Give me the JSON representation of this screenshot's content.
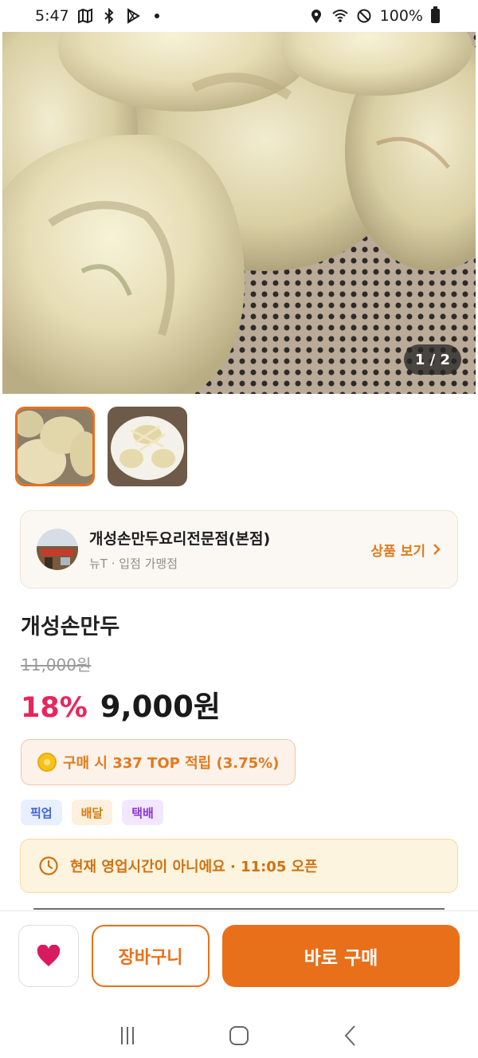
{
  "status_bar": {
    "time": "5:47",
    "battery": "100%",
    "left_icons": [
      "map-icon",
      "bluetooth-icon",
      "play-store-icon",
      "dot-icon"
    ],
    "right_icons": [
      "location-icon",
      "wifi-icon",
      "do-not-disturb-icon",
      "battery-icon"
    ]
  },
  "gallery": {
    "page_indicator": "1 / 2",
    "current_page": 1,
    "total_pages": 2
  },
  "shop": {
    "name": "개성손만두요리전문점(본점)",
    "subtitle": "뉴T · 입점 가맹점",
    "link_label": "상품 보기"
  },
  "product": {
    "name": "개성손만두",
    "original_price": "11,000원",
    "discount": "18%",
    "sale_price": "9,000원"
  },
  "points": {
    "text": "구매 시 337 TOP 적립 (3.75%)"
  },
  "tags": [
    {
      "label": "픽업"
    },
    {
      "label": "배달"
    },
    {
      "label": "택배"
    }
  ],
  "notice": {
    "text": "현재 영업시간이 아니에요 · 11:05 오픈"
  },
  "actions": {
    "cart_label": "장바구니",
    "buy_label": "바로 구매"
  },
  "colors": {
    "accent": "#e8701a",
    "discount": "#e8265e",
    "heart": "#d81b60"
  }
}
